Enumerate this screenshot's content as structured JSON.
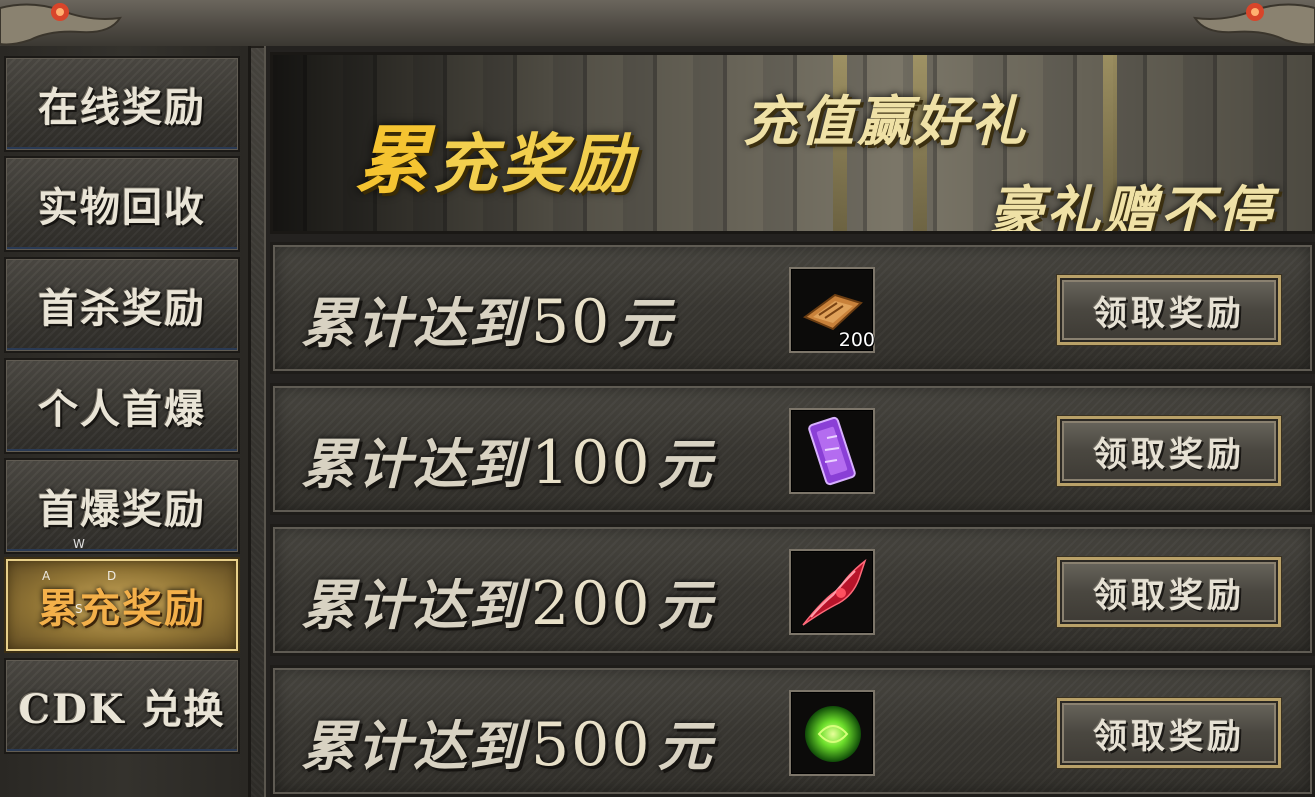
{
  "sidebar": {
    "items": [
      {
        "label": "在线奖励",
        "active": false
      },
      {
        "label": "实物回收",
        "active": false
      },
      {
        "label": "首杀奖励",
        "active": false
      },
      {
        "label": "个人首爆",
        "active": false
      },
      {
        "label": "首爆奖励",
        "active": false
      },
      {
        "label": "累充奖励",
        "active": true
      },
      {
        "label": "CDK 兑换",
        "active": false
      }
    ]
  },
  "banner": {
    "title_first": "累",
    "title_rest": "充奖励",
    "slogan_line1": "充值赢好礼",
    "slogan_line2": "豪礼赠不停"
  },
  "rewards": [
    {
      "prefix": "累计达到",
      "amount": "50",
      "unit": "元",
      "item_icon": "scroll-icon",
      "quantity": "200",
      "claim_label": "领取奖励"
    },
    {
      "prefix": "累计达到",
      "amount": "100",
      "unit": "元",
      "item_icon": "purple-token-icon",
      "quantity": "",
      "claim_label": "领取奖励"
    },
    {
      "prefix": "累计达到",
      "amount": "200",
      "unit": "元",
      "item_icon": "red-wings-icon",
      "quantity": "",
      "claim_label": "领取奖励"
    },
    {
      "prefix": "累计达到",
      "amount": "500",
      "unit": "元",
      "item_icon": "green-orb-icon",
      "quantity": "",
      "claim_label": "领取奖励"
    }
  ],
  "controls_overlay": {
    "w": "W",
    "a": "A",
    "s": "S",
    "d": "D"
  },
  "colors": {
    "active_tab": "#c9a75a",
    "gold_text": "#f2cf4e",
    "button_border": "#b9a168"
  }
}
